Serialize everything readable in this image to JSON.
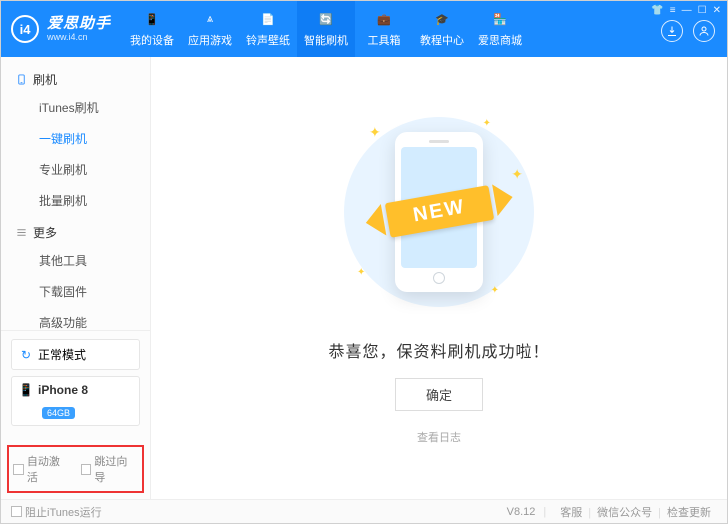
{
  "app": {
    "name": "爱思助手",
    "url": "www.i4.cn",
    "logoLetters": "i4"
  },
  "nav": [
    {
      "id": "device",
      "label": "我的设备",
      "icon": "📱"
    },
    {
      "id": "apps",
      "label": "应用游戏",
      "icon": "⩓"
    },
    {
      "id": "ringtone",
      "label": "铃声壁纸",
      "icon": "📄"
    },
    {
      "id": "flash",
      "label": "智能刷机",
      "icon": "🔄",
      "active": true
    },
    {
      "id": "tools",
      "label": "工具箱",
      "icon": "💼"
    },
    {
      "id": "tutorial",
      "label": "教程中心",
      "icon": "🎓"
    },
    {
      "id": "store",
      "label": "爱思商城",
      "icon": "🏪"
    }
  ],
  "sidebar": {
    "groups": [
      {
        "title": "刷机",
        "iconType": "phone",
        "items": [
          {
            "label": "iTunes刷机"
          },
          {
            "label": "一键刷机",
            "active": true
          },
          {
            "label": "专业刷机"
          },
          {
            "label": "批量刷机"
          }
        ]
      },
      {
        "title": "更多",
        "iconType": "menu",
        "items": [
          {
            "label": "其他工具"
          },
          {
            "label": "下载固件"
          },
          {
            "label": "高级功能"
          }
        ]
      }
    ],
    "mode": {
      "label": "正常模式"
    },
    "device": {
      "name": "iPhone 8",
      "storage": "64GB"
    },
    "checks": {
      "autoActivate": "自动激活",
      "skipGuide": "跳过向导"
    }
  },
  "main": {
    "ribbon": "NEW",
    "message": "恭喜您，保资料刷机成功啦！",
    "confirm": "确定",
    "viewLog": "查看日志"
  },
  "footer": {
    "blockItunes": "阻止iTunes运行",
    "version": "V8.12",
    "links": [
      "客服",
      "微信公众号",
      "检查更新"
    ]
  }
}
